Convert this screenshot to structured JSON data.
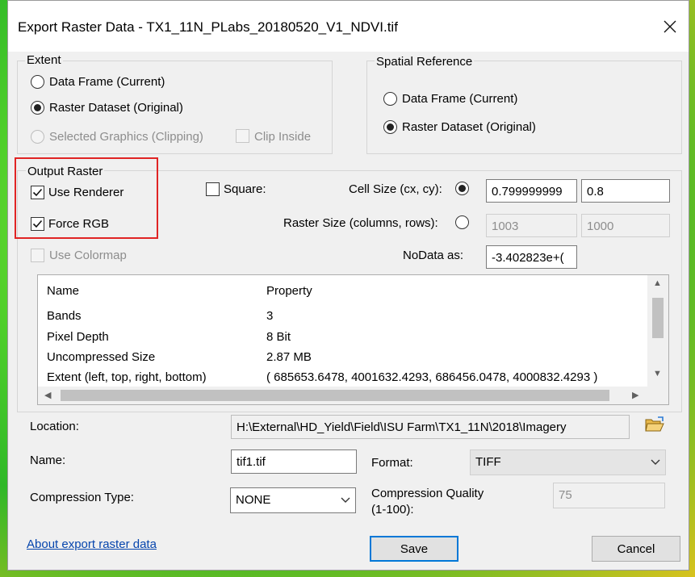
{
  "window": {
    "title": "Export Raster Data - TX1_11N_PLabs_20180520_V1_NDVI.tif"
  },
  "extent": {
    "group_label": "Extent",
    "data_frame_label": "Data Frame (Current)",
    "raster_dataset_label": "Raster Dataset (Original)",
    "selected_graphics_label": "Selected Graphics (Clipping)",
    "clip_inside_label": "Clip Inside"
  },
  "spatial_reference": {
    "group_label": "Spatial Reference",
    "data_frame_label": "Data Frame (Current)",
    "raster_dataset_label": "Raster Dataset (Original)"
  },
  "output_raster": {
    "group_label": "Output Raster",
    "use_renderer_label": "Use Renderer",
    "force_rgb_label": "Force RGB",
    "use_colormap_label": "Use Colormap",
    "square_label": "Square:",
    "cell_size_label": "Cell Size (cx, cy):",
    "cell_size_x": "0.799999999",
    "cell_size_y": "0.8",
    "raster_size_label": "Raster Size (columns, rows):",
    "raster_columns": "1003",
    "raster_rows": "1000",
    "nodata_label": "NoData as:",
    "nodata_value": "-3.402823e+("
  },
  "properties": {
    "headers": [
      "Name",
      "Property"
    ],
    "rows": [
      [
        "Bands",
        "3"
      ],
      [
        "Pixel Depth",
        "8 Bit"
      ],
      [
        "Uncompressed Size",
        "2.87 MB"
      ],
      [
        "Extent (left, top, right, bottom)",
        "( 685653.6478, 4001632.4293, 686456.0478, 4000832.4293 )"
      ]
    ]
  },
  "location": {
    "label": "Location:",
    "value": "H:\\External\\HD_Yield\\Field\\ISU Farm\\TX1_11N\\2018\\Imagery"
  },
  "name": {
    "label": "Name:",
    "value": "tif1.tif"
  },
  "format": {
    "label": "Format:",
    "value": "TIFF"
  },
  "compression": {
    "type_label": "Compression Type:",
    "type_value": "NONE",
    "quality_label_line1": "Compression Quality",
    "quality_label_line2": "(1-100):",
    "quality_value": "75"
  },
  "footer": {
    "help_link": "About export raster data",
    "save_label": "Save",
    "cancel_label": "Cancel"
  },
  "colors": {
    "highlight_box": "#e02424",
    "link": "#0645ad",
    "default_button_border": "#0078d7"
  }
}
